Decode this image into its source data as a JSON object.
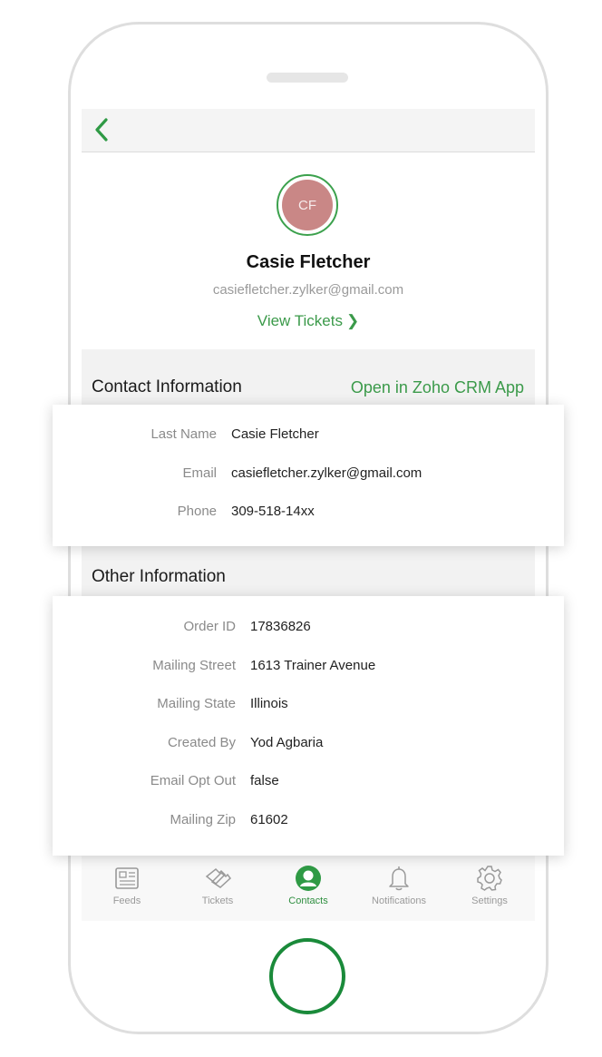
{
  "contact": {
    "initials": "CF",
    "name": "Casie Fletcher",
    "email": "casiefletcher.zylker@gmail.com",
    "view_tickets_label": "View Tickets",
    "avatar_color": "#c98786"
  },
  "contact_section": {
    "title": "Contact Information",
    "link_label": "Open in Zoho CRM App",
    "fields": [
      {
        "label": "Last Name",
        "value": "Casie Fletcher"
      },
      {
        "label": "Email",
        "value": "casiefletcher.zylker@gmail.com"
      },
      {
        "label": "Phone",
        "value": "309-518-14xx"
      }
    ]
  },
  "other_section": {
    "title": "Other Information",
    "fields": [
      {
        "label": "Order ID",
        "value": "17836826"
      },
      {
        "label": "Mailing Street",
        "value": "1613 Trainer Avenue"
      },
      {
        "label": "Mailing State",
        "value": "Illinois"
      },
      {
        "label": "Created By",
        "value": "Yod Agbaria"
      },
      {
        "label": "Email Opt Out",
        "value": "false"
      },
      {
        "label": "Mailing Zip",
        "value": "61602"
      }
    ]
  },
  "tabbar": {
    "items": [
      {
        "label": "Feeds",
        "icon": "feeds-icon"
      },
      {
        "label": "Tickets",
        "icon": "tickets-icon"
      },
      {
        "label": "Contacts",
        "icon": "contacts-icon",
        "active": true
      },
      {
        "label": "Notifications",
        "icon": "bell-icon"
      },
      {
        "label": "Settings",
        "icon": "gear-icon"
      }
    ]
  },
  "colors": {
    "accent_green": "#3b9a4a",
    "home_button": "#1a8a3a"
  }
}
